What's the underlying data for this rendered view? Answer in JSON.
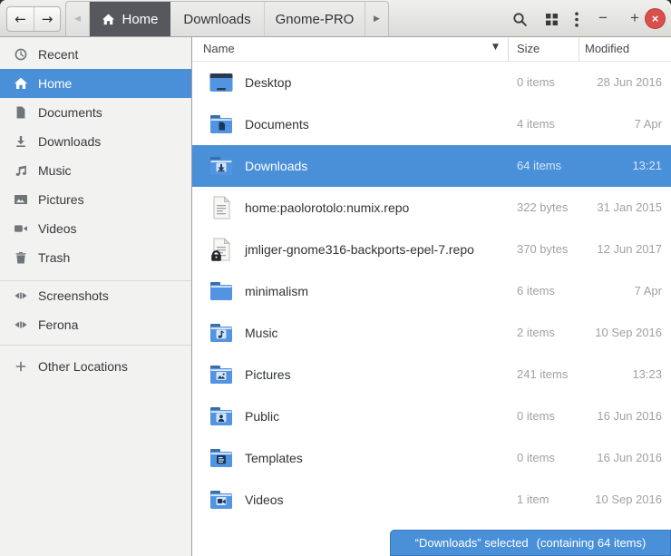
{
  "titlebar": {
    "back_glyph": "←",
    "forward_glyph": "→",
    "tab_scroll_left_glyph": "◀",
    "tab_scroll_right_glyph": "▶",
    "tabs": [
      {
        "label": "Home",
        "active": true,
        "icon": "home-icon"
      },
      {
        "label": "Downloads",
        "active": false
      },
      {
        "label": "Gnome-PRO",
        "active": false
      }
    ],
    "minimize_glyph": "−",
    "maximize_glyph": "+",
    "close_glyph": "×"
  },
  "sidebar": {
    "items": [
      {
        "label": "Recent",
        "icon": "clock-icon",
        "icon_ref": "#s-clock",
        "selected": false
      },
      {
        "label": "Home",
        "icon": "home-icon",
        "icon_ref": "#s-home",
        "selected": true
      },
      {
        "label": "Documents",
        "icon": "document-icon",
        "icon_ref": "#s-document",
        "selected": false
      },
      {
        "label": "Downloads",
        "icon": "download-icon",
        "icon_ref": "#s-download",
        "selected": false
      },
      {
        "label": "Music",
        "icon": "music-icon",
        "icon_ref": "#s-music",
        "selected": false
      },
      {
        "label": "Pictures",
        "icon": "image-icon",
        "icon_ref": "#s-image",
        "selected": false
      },
      {
        "label": "Videos",
        "icon": "video-icon",
        "icon_ref": "#s-video",
        "selected": false
      },
      {
        "label": "Trash",
        "icon": "trash-icon",
        "icon_ref": "#s-trash",
        "selected": false
      }
    ],
    "devices": [
      {
        "label": "Screenshots",
        "icon": "drive-icon",
        "icon_ref": "#s-drive"
      },
      {
        "label": "Ferona",
        "icon": "drive-icon",
        "icon_ref": "#s-drive"
      }
    ],
    "other_locations": {
      "label": "Other Locations",
      "icon": "plus-icon",
      "icon_ref": "#s-plus"
    }
  },
  "list": {
    "columns": {
      "name": "Name",
      "size": "Size",
      "modified": "Modified"
    },
    "sort_glyph": "▼",
    "rows": [
      {
        "name": "Desktop",
        "size": "0 items",
        "modified": "28 Jun 2016",
        "icon": "desktop-icon",
        "icon_ref": "#i-desktop",
        "selected": false
      },
      {
        "name": "Documents",
        "size": "4 items",
        "modified": "7 Apr",
        "icon": "folder-documents-icon",
        "icon_ref": "#i-folder-documents",
        "selected": false
      },
      {
        "name": "Downloads",
        "size": "64 items",
        "modified": "13:21",
        "icon": "folder-downloads-icon",
        "icon_ref": "#i-folder-downloads",
        "selected": true
      },
      {
        "name": "home:paolorotolo:numix.repo",
        "size": "322 bytes",
        "modified": "31 Jan 2015",
        "icon": "text-file-icon",
        "icon_ref": "#i-file-text",
        "selected": false
      },
      {
        "name": "jmliger-gnome316-backports-epel-7.repo",
        "size": "370 bytes",
        "modified": "12 Jun 2017",
        "icon": "locked-text-file-icon",
        "icon_ref": "#i-file-lock",
        "selected": false
      },
      {
        "name": "minimalism",
        "size": "6 items",
        "modified": "7 Apr",
        "icon": "folder-icon",
        "icon_ref": "#i-folder",
        "selected": false
      },
      {
        "name": "Music",
        "size": "2 items",
        "modified": "10 Sep 2016",
        "icon": "folder-music-icon",
        "icon_ref": "#i-folder-music",
        "selected": false
      },
      {
        "name": "Pictures",
        "size": "241 items",
        "modified": "13:23",
        "icon": "folder-pictures-icon",
        "icon_ref": "#i-folder-pictures",
        "selected": false
      },
      {
        "name": "Public",
        "size": "0 items",
        "modified": "16 Jun 2016",
        "icon": "folder-public-icon",
        "icon_ref": "#i-folder-public",
        "selected": false
      },
      {
        "name": "Templates",
        "size": "0 items",
        "modified": "16 Jun 2016",
        "icon": "folder-templates-icon",
        "icon_ref": "#i-folder-templates",
        "selected": false
      },
      {
        "name": "Videos",
        "size": "1 item",
        "modified": "10 Sep 2016",
        "icon": "folder-videos-icon",
        "icon_ref": "#i-folder-videos",
        "selected": false
      }
    ]
  },
  "statusbar": {
    "selection": "“Downloads” selected",
    "detail": "(containing 64 items)"
  },
  "colors": {
    "selection_blue": "#4a90d9",
    "active_tab": "#56585d",
    "close_button_red": "#d9504a",
    "folder_blue": "#5294e2"
  }
}
